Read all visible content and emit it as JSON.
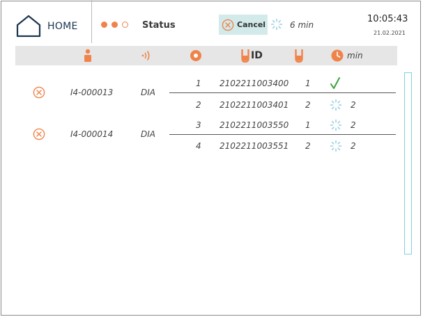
{
  "header": {
    "home_label": "HOME",
    "status_label": "Status",
    "status_dots": [
      "filled",
      "filled",
      "empty"
    ],
    "cancel_label": "Cancel",
    "timer_text": "6 min",
    "time": "10:05:43",
    "date": "21.02.2021"
  },
  "columns": {
    "id_label": "ID",
    "min_label": "min"
  },
  "samples": [
    {
      "patient_id": "I4-000013",
      "type": "DIA",
      "tubes": [
        {
          "pos": "1",
          "barcode": "2102211003400",
          "count": "1",
          "status": "done",
          "minutes": ""
        },
        {
          "pos": "2",
          "barcode": "2102211003401",
          "count": "2",
          "status": "running",
          "minutes": "2"
        }
      ]
    },
    {
      "patient_id": "I4-000014",
      "type": "DIA",
      "tubes": [
        {
          "pos": "3",
          "barcode": "2102211003550",
          "count": "1",
          "status": "running",
          "minutes": "2"
        },
        {
          "pos": "4",
          "barcode": "2102211003551",
          "count": "2",
          "status": "running",
          "minutes": "2"
        }
      ]
    }
  ],
  "colors": {
    "accent_orange": "#f0834a",
    "cancel_bg": "#d2eaea",
    "check_green": "#3aa33a",
    "spinner_blue": "#9ad0e6",
    "home_navy": "#1a3550",
    "scroll_border": "#7fd0e0"
  },
  "icons": {
    "home": "home-icon",
    "cancel": "cancel-x-circle-icon",
    "spinner": "spinner-icon",
    "person": "person-icon",
    "signal": "signal-waves-icon",
    "position": "position-circle-icon",
    "tube": "tube-icon",
    "clock": "clock-icon",
    "check": "check-icon"
  }
}
